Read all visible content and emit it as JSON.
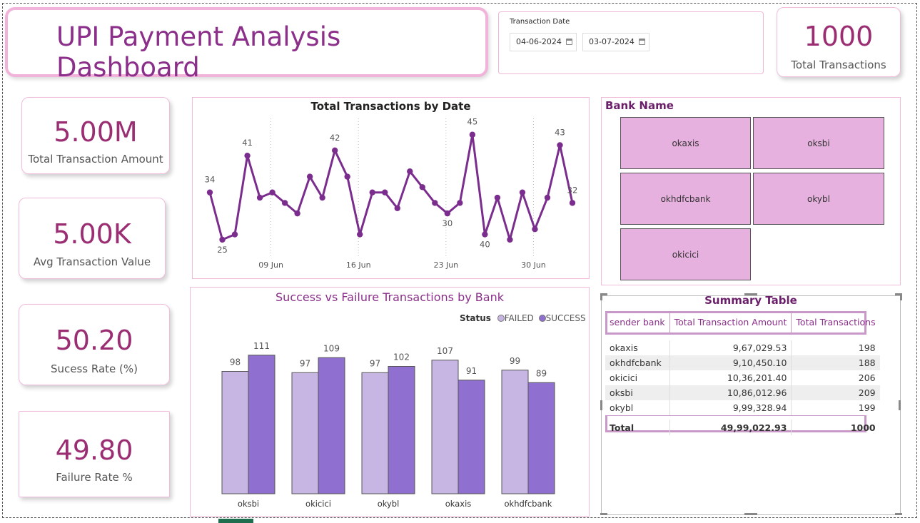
{
  "header": {
    "title": "UPI Payment Analysis Dashboard"
  },
  "date_filter": {
    "label": "Transaction Date",
    "start": "04-06-2024",
    "end": "03-07-2024"
  },
  "kpis": {
    "total_transactions": {
      "value": "1000",
      "label": "Total Transactions"
    },
    "total_amount": {
      "value": "5.00M",
      "label": "Total Transaction Amount"
    },
    "avg_value": {
      "value": "5.00K",
      "label": "Avg Transaction Value"
    },
    "success_rate": {
      "value": "50.20",
      "label": "Sucess Rate (%)"
    },
    "failure_rate": {
      "value": "49.80",
      "label": "Failure Rate %"
    }
  },
  "line_chart": {
    "title": "Total Transactions by Date",
    "x_ticks": [
      "09 Jun",
      "16 Jun",
      "23 Jun",
      "30 Jun"
    ]
  },
  "bank_slicer": {
    "title": "Bank Name",
    "banks": [
      "okaxis",
      "oksbi",
      "okhdfcbank",
      "okybl",
      "okicici"
    ]
  },
  "bar_chart": {
    "title": "Success vs Failure Transactions by Bank",
    "legend_title": "Status",
    "legend": [
      "FAILED",
      "SUCCESS"
    ]
  },
  "summary_table": {
    "title": "Summary Table",
    "columns": [
      "sender bank",
      "Total Transaction Amount",
      "Total Transactions"
    ],
    "rows": [
      [
        "okaxis",
        "9,67,029.53",
        "198"
      ],
      [
        "okhdfcbank",
        "9,10,450.10",
        "188"
      ],
      [
        "okicici",
        "10,36,201.40",
        "206"
      ],
      [
        "oksbi",
        "10,86,012.96",
        "209"
      ],
      [
        "okybl",
        "9,99,328.94",
        "199"
      ]
    ],
    "total": [
      "Total",
      "49,99,022.93",
      "1000"
    ]
  },
  "colors": {
    "accent": "#9b2d73",
    "line": "#7b2d8e",
    "failed": "#c7b6e4",
    "success": "#8f6fcf",
    "tile": "#e6b1de"
  },
  "chart_data": [
    {
      "type": "line",
      "title": "Total Transactions by Date",
      "x": [
        "04 Jun",
        "05 Jun",
        "06 Jun",
        "07 Jun",
        "08 Jun",
        "09 Jun",
        "10 Jun",
        "11 Jun",
        "12 Jun",
        "13 Jun",
        "14 Jun",
        "15 Jun",
        "16 Jun",
        "17 Jun",
        "18 Jun",
        "19 Jun",
        "20 Jun",
        "21 Jun",
        "22 Jun",
        "23 Jun",
        "24 Jun",
        "25 Jun",
        "26 Jun",
        "27 Jun",
        "28 Jun",
        "29 Jun",
        "30 Jun",
        "01 Jul",
        "02 Jul",
        "03 Jul"
      ],
      "values": [
        34,
        25,
        26,
        41,
        33,
        34,
        32,
        30,
        37,
        33,
        42,
        37,
        26,
        34,
        34,
        31,
        38,
        35,
        32,
        30,
        32,
        45,
        26,
        33,
        25,
        34,
        27,
        33,
        43,
        32
      ],
      "data_labels": {
        "0": "34",
        "1": "25",
        "3": "41",
        "10": "42",
        "19": "30",
        "21": "45",
        "22": "40",
        "28": "43",
        "29": "32"
      },
      "x_ticks": [
        "09 Jun",
        "16 Jun",
        "23 Jun",
        "30 Jun"
      ],
      "ylim": [
        22,
        47
      ]
    },
    {
      "type": "bar",
      "title": "Success vs Failure Transactions by Bank",
      "categories": [
        "oksbi",
        "okicici",
        "okybl",
        "okaxis",
        "okhdfcbank"
      ],
      "series": [
        {
          "name": "FAILED",
          "values": [
            98,
            97,
            97,
            107,
            99
          ]
        },
        {
          "name": "SUCCESS",
          "values": [
            111,
            109,
            102,
            91,
            89
          ]
        }
      ],
      "ylim": [
        0,
        120
      ]
    }
  ]
}
